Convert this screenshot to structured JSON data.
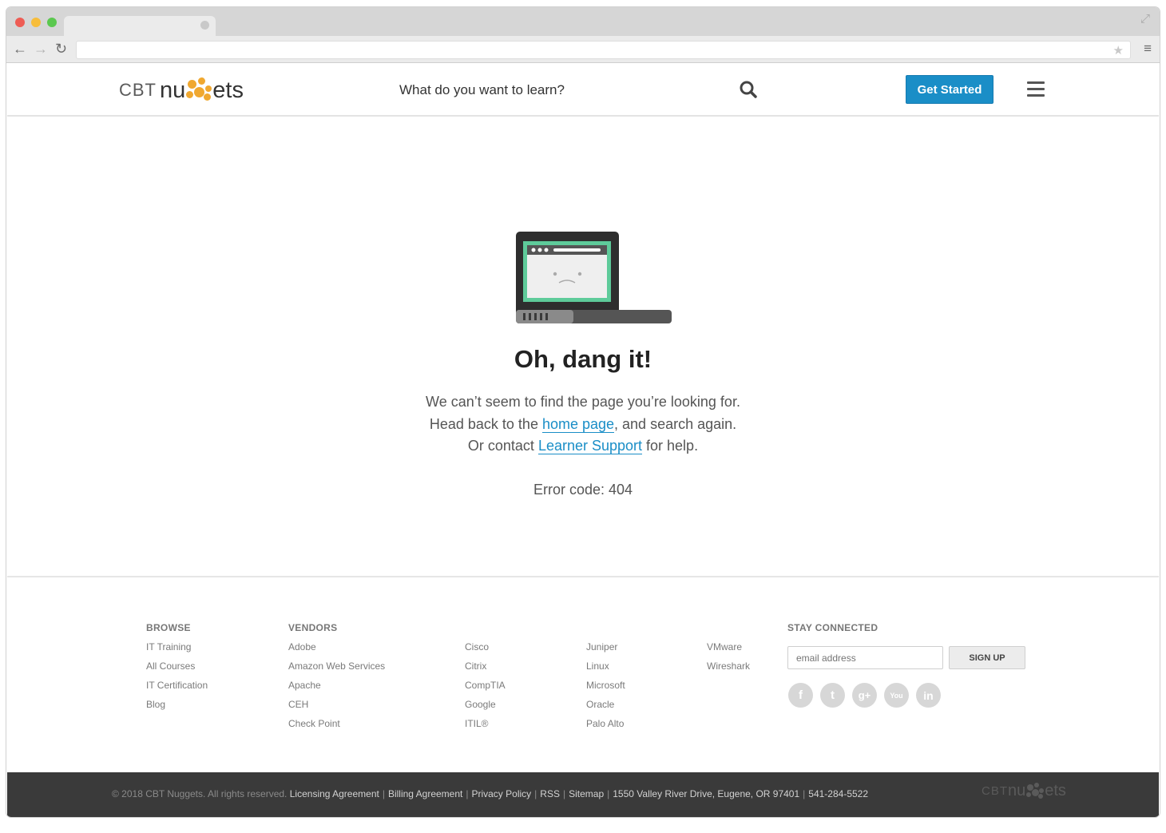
{
  "browser": {
    "tab_title": "",
    "url": ""
  },
  "header": {
    "logo_cbt": "CBT",
    "logo_nu": "nu",
    "logo_ets": "ets",
    "search_prompt": "What do you want to learn?",
    "get_started_label": "Get Started"
  },
  "error": {
    "title": "Oh, dang it!",
    "line1": "We can’t seem to find the page you’re looking for.",
    "line2_prefix": "Head back to the ",
    "home_link": "home page",
    "line2_suffix": ", and search again.",
    "line3_prefix": "Or contact ",
    "support_link": "Learner Support",
    "line3_suffix": " for help.",
    "code": "Error code: 404"
  },
  "footer": {
    "browse": {
      "heading": "BROWSE",
      "links": [
        "IT Training",
        "All Courses",
        "IT Certification",
        "Blog"
      ]
    },
    "vendors": {
      "heading": "VENDORS",
      "col1": [
        "Adobe",
        "Amazon Web Services",
        "Apache",
        "CEH",
        "Check Point"
      ],
      "col2": [
        "Cisco",
        "Citrix",
        "CompTIA",
        "Google",
        "ITIL®"
      ],
      "col3": [
        "Juniper",
        "Linux",
        "Microsoft",
        "Oracle",
        "Palo Alto"
      ],
      "col4": [
        "VMware",
        "Wireshark"
      ]
    },
    "stay_connected": {
      "heading": "STAY CONNECTED",
      "email_placeholder": "email address",
      "signup_label": "SIGN UP",
      "social": [
        {
          "icon": "facebook-icon",
          "glyph": "f"
        },
        {
          "icon": "twitter-icon",
          "glyph": "t"
        },
        {
          "icon": "google-plus-icon",
          "glyph": "g+"
        },
        {
          "icon": "youtube-icon",
          "glyph": "You"
        },
        {
          "icon": "linkedin-icon",
          "glyph": "in"
        }
      ]
    }
  },
  "legal": {
    "copyright": "© 2018 CBT Nuggets. All rights reserved.",
    "links": [
      "Licensing Agreement",
      "Billing Agreement",
      "Privacy Policy",
      "RSS",
      "Sitemap"
    ],
    "address": "1550 Valley River Drive, Eugene, OR 97401",
    "phone": "541-284-5522"
  },
  "colors": {
    "accent": "#1a8ec7",
    "logo_dots": "#f0a830",
    "footer_bar": "#3a3a3a"
  }
}
